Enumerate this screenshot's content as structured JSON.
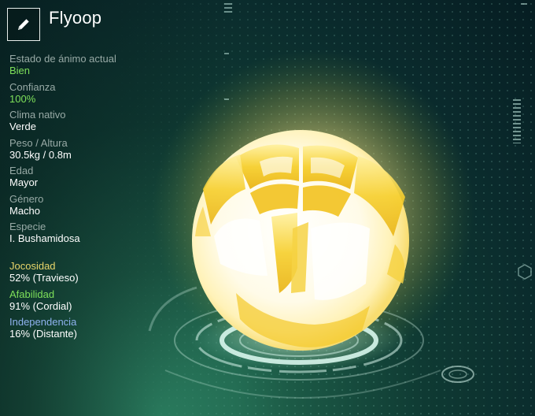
{
  "header": {
    "title": "Flyoop",
    "edit_icon": "pencil-icon"
  },
  "stats": [
    {
      "label": "Estado de ánimo actual",
      "value": "Bien",
      "value_color": "#7ee05a"
    },
    {
      "label": "Confianza",
      "value": "100%",
      "value_color": "#7ee05a"
    },
    {
      "label": "Clima nativo",
      "value": "Verde",
      "value_color": "#ffffff"
    },
    {
      "label": "Peso / Altura",
      "value": "30.5kg / 0.8m",
      "value_color": "#ffffff"
    },
    {
      "label": "Edad",
      "value": "Mayor",
      "value_color": "#ffffff"
    },
    {
      "label": "Género",
      "value": "Macho",
      "value_color": "#ffffff"
    },
    {
      "label": "Especie",
      "value": "I. Bushamidosa",
      "value_color": "#ffffff"
    }
  ],
  "traits": [
    {
      "label": "Jocosidad",
      "value": "52% (Travieso)",
      "label_color": "#e8d56a"
    },
    {
      "label": "Afabilidad",
      "value": "91% (Cordial)",
      "label_color": "#7ee05a"
    },
    {
      "label": "Independencia",
      "value": "16% (Distante)",
      "label_color": "#8fb2ef"
    }
  ],
  "creature": {
    "name": "glowing-egg-creature",
    "glow_color": "#fff3b0",
    "shell_color": "#f5c518"
  }
}
